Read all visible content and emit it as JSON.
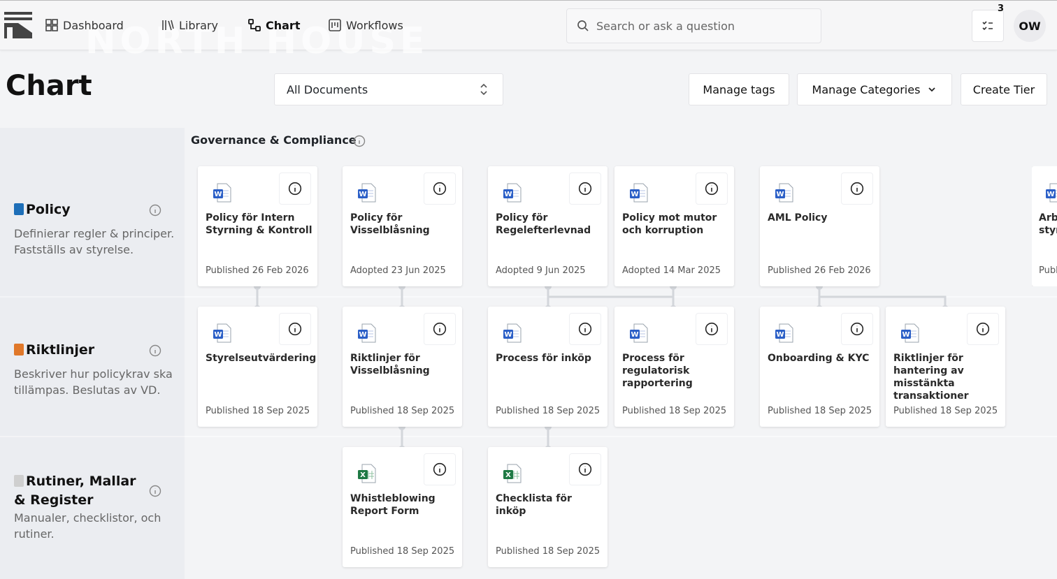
{
  "brand": {
    "name": "NORTH HOUSE"
  },
  "nav": [
    {
      "label": "Dashboard",
      "icon": "dashboard-icon"
    },
    {
      "label": "Library",
      "icon": "library-icon"
    },
    {
      "label": "Chart",
      "icon": "chart-icon"
    },
    {
      "label": "Workflows",
      "icon": "workflows-icon"
    }
  ],
  "search": {
    "placeholder": "Search or ask a question"
  },
  "notifications": {
    "count": "3"
  },
  "user": {
    "initials": "OW"
  },
  "page": {
    "title": "Chart"
  },
  "filter": {
    "selected": "All Documents"
  },
  "actions": {
    "manage_tags": "Manage tags",
    "manage_categories": "Manage Categories",
    "create_tier": "Create Tier"
  },
  "section": {
    "title": "Governance & Compliance"
  },
  "tiers": [
    {
      "title": "Policy",
      "description": "Definierar regler & principer. Fastställs av styrelse.",
      "color": "#1e6fb8"
    },
    {
      "title": "Riktlinjer",
      "description": "Beskriver hur policykrav ska tillämpas. Beslutas av VD.",
      "color": "#e0782a"
    },
    {
      "title": "Rutiner, Mallar & Register",
      "description": "Manualer, checklistor, och rutiner.",
      "color": "#cfcfcf"
    }
  ],
  "cards": {
    "policy": [
      {
        "title": "Policy för Intern Styrning & Kontroll",
        "status": "Published 26 Feb 2026",
        "type": "word"
      },
      {
        "title": "Policy för Visselblåsning",
        "status": "Adopted 23 Jun 2025",
        "type": "word"
      },
      {
        "title": "Policy för Regelefterlevnad",
        "status": "Adopted 9 Jun 2025",
        "type": "word"
      },
      {
        "title": "Policy mot mutor och korruption",
        "status": "Adopted 14 Mar 2025",
        "type": "word"
      },
      {
        "title": "AML Policy",
        "status": "Published 26 Feb 2026",
        "type": "word"
      },
      {
        "title": "Arbe styr",
        "status": "Publ",
        "type": "word"
      }
    ],
    "riktlinjer": [
      {
        "title": "Styrelseutvärdering",
        "status": "Published 18 Sep 2025",
        "type": "word"
      },
      {
        "title": "Riktlinjer för Visselblåsning",
        "status": "Published 18 Sep 2025",
        "type": "word"
      },
      {
        "title": "Process för inköp",
        "status": "Published 18 Sep 2025",
        "type": "word"
      },
      {
        "title": "Process för regulatorisk rapportering",
        "status": "Published 18 Sep 2025",
        "type": "word"
      },
      {
        "title": "Onboarding & KYC",
        "status": "Published 18 Sep 2025",
        "type": "word"
      },
      {
        "title": "Riktlinjer för hantering av misstänkta transaktioner",
        "status": "Published 18 Sep 2025",
        "type": "word"
      }
    ],
    "rutiner": [
      {
        "title": "Whistleblowing Report Form",
        "status": "Published 18 Sep 2025",
        "type": "excel"
      },
      {
        "title": "Checklista för inköp",
        "status": "Published 18 Sep 2025",
        "type": "excel"
      }
    ]
  },
  "colors": {
    "word": "#2b5fc7",
    "excel": "#1f7a44",
    "connector": "#d3d6db"
  }
}
